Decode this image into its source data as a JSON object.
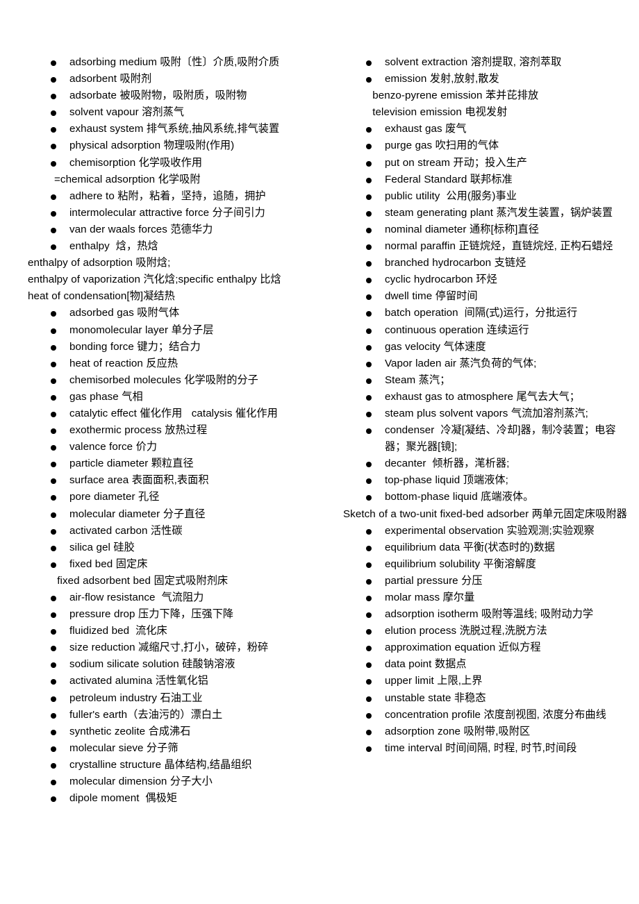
{
  "document": {
    "type": "bilingual-glossary",
    "subject": "Adsorption engineering English-Chinese vocabulary",
    "background_color": "#ffffff",
    "text_color": "#000000"
  },
  "left_column": [
    {
      "style": "bulleted",
      "text": "adsorbing medium 吸附〔性〕介质,吸附介质"
    },
    {
      "style": "bulleted",
      "text": "adsorbent 吸附剂"
    },
    {
      "style": "bulleted",
      "text": "adsorbate 被吸附物，吸附质，吸附物"
    },
    {
      "style": "bulleted",
      "text": "solvent vapour 溶剂蒸气"
    },
    {
      "style": "bulleted",
      "text": "exhaust system 排气系统,抽风系统,排气装置"
    },
    {
      "style": "bulleted",
      "text": "physical adsorption 物理吸附(作用)"
    },
    {
      "style": "bulleted",
      "text": "chemisorption 化学吸收作用"
    },
    {
      "style": "indented",
      "text": "=chemical adsorption 化学吸附"
    },
    {
      "style": "bulleted",
      "text": "adhere to 粘附，粘着，坚持，追随，拥护"
    },
    {
      "style": "bulleted",
      "text": "intermolecular attractive force 分子间引力"
    },
    {
      "style": "bulleted",
      "text": "van der waals forces 范德华力"
    },
    {
      "style": "bulleted",
      "text": "enthalpy  焓，热焓"
    },
    {
      "style": "flush",
      "text": "enthalpy of adsorption 吸附焓;"
    },
    {
      "style": "flush",
      "text": "enthalpy of vaporization 汽化焓;specific enthalpy 比焓"
    },
    {
      "style": "flush",
      "text": "heat of condensation[物]凝结热"
    },
    {
      "style": "bulleted",
      "text": "adsorbed gas 吸附气体"
    },
    {
      "style": "bulleted",
      "text": "monomolecular layer 单分子层"
    },
    {
      "style": "bulleted",
      "text": "bonding force 键力；结合力"
    },
    {
      "style": "bulleted",
      "text": "heat of reaction 反应热"
    },
    {
      "style": "bulleted",
      "text": "chemisorbed molecules 化学吸附的分子"
    },
    {
      "style": "bulleted",
      "text": "gas phase 气相"
    },
    {
      "style": "bulleted",
      "text": "catalytic effect 催化作用   catalysis 催化作用"
    },
    {
      "style": "bulleted",
      "text": "exothermic process 放热过程"
    },
    {
      "style": "bulleted",
      "text": "valence force 价力"
    },
    {
      "style": "bulleted",
      "text": "particle diameter 颗粒直径"
    },
    {
      "style": "bulleted",
      "text": "surface area 表面面积,表面积"
    },
    {
      "style": "bulleted",
      "text": "pore diameter 孔径"
    },
    {
      "style": "bulleted",
      "text": "molecular diameter 分子直径"
    },
    {
      "style": "bulleted",
      "text": "activated carbon 活性碳"
    },
    {
      "style": "bulleted",
      "text": "silica gel 硅胶"
    },
    {
      "style": "bulleted",
      "text": "fixed bed 固定床"
    },
    {
      "style": "indented",
      "text": " fixed adsorbent bed 固定式吸附剂床"
    },
    {
      "style": "bulleted",
      "text": "air-flow resistance  气流阻力"
    },
    {
      "style": "bulleted",
      "text": "pressure drop 压力下降，压强下降"
    },
    {
      "style": "bulleted",
      "text": "fluidized bed  流化床"
    },
    {
      "style": "bulleted",
      "text": "size reduction 减缩尺寸,打小，破碎，粉碎"
    },
    {
      "style": "bulleted",
      "text": "sodium silicate solution 硅酸钠溶液"
    },
    {
      "style": "bulleted",
      "text": "activated alumina 活性氧化铝"
    },
    {
      "style": "bulleted",
      "text": "petroleum industry 石油工业"
    },
    {
      "style": "bulleted",
      "text": "fuller's earth（去油污的）漂白土"
    },
    {
      "style": "bulleted",
      "text": "synthetic zeolite 合成沸石"
    },
    {
      "style": "bulleted",
      "text": "molecular sieve 分子筛"
    },
    {
      "style": "bulleted",
      "text": "crystalline structure 晶体结构,结晶组织"
    },
    {
      "style": "bulleted",
      "text": "molecular dimension 分子大小"
    },
    {
      "style": "bulleted",
      "text": "dipole moment  偶极矩"
    }
  ],
  "right_column": [
    {
      "style": "bulleted",
      "text": "solvent extraction 溶剂提取, 溶剂萃取"
    },
    {
      "style": "bulleted",
      "text": "emission 发射,放射,散发"
    },
    {
      "style": "indented",
      "text": " benzo-pyrene emission 苯并芘排放"
    },
    {
      "style": "indented",
      "text": " television emission 电视发射"
    },
    {
      "style": "bulleted",
      "text": "exhaust gas 废气"
    },
    {
      "style": "bulleted",
      "text": "purge gas 吹扫用的气体"
    },
    {
      "style": "bulleted",
      "text": "put on stream 开动；投入生产"
    },
    {
      "style": "bulleted",
      "text": "Federal Standard 联邦标准"
    },
    {
      "style": "bulleted",
      "text": "public utility  公用(服务)事业"
    },
    {
      "style": "bulleted",
      "text": "steam generating plant 蒸汽发生装置，锅炉装置"
    },
    {
      "style": "bulleted",
      "text": "nominal diameter 通称[标称]直径"
    },
    {
      "style": "bulleted",
      "text": "normal paraffin 正链烷烃，直链烷烃, 正构石蜡烃"
    },
    {
      "style": "bulleted",
      "text": "branched hydrocarbon 支链烃"
    },
    {
      "style": "bulleted",
      "text": "cyclic hydrocarbon 环烃"
    },
    {
      "style": "bulleted",
      "text": "dwell time 停留时间"
    },
    {
      "style": "bulleted",
      "text": "batch operation  间隔(式)运行，分批运行"
    },
    {
      "style": "bulleted",
      "text": "continuous operation 连续运行"
    },
    {
      "style": "bulleted",
      "text": "gas velocity 气体速度"
    },
    {
      "style": "bulleted",
      "text": "Vapor laden air 蒸汽负荷的气体;"
    },
    {
      "style": "bulleted",
      "text": "Steam 蒸汽；"
    },
    {
      "style": "bulleted",
      "text": "exhaust gas to atmosphere 尾气去大气；"
    },
    {
      "style": "bulleted",
      "text": "steam plus solvent vapors 气流加溶剂蒸汽;"
    },
    {
      "style": "bulleted",
      "text": "condenser  冷凝[凝结、冷却]器，制冷装置；电容器；聚光器[镜];"
    },
    {
      "style": "bulleted",
      "text": "decanter  倾析器，滗析器;"
    },
    {
      "style": "bulleted",
      "text": "top-phase liquid 顶端液体;"
    },
    {
      "style": "bulleted",
      "text": "bottom-phase liquid 底端液体。"
    },
    {
      "style": "flush",
      "text": "Sketch of a two-unit fixed-bed adsorber 两单元固定床吸附器"
    },
    {
      "style": "bulleted",
      "text": "experimental observation 实验观测;实验观察"
    },
    {
      "style": "bulleted",
      "text": "equilibrium data 平衡(状态时的)数据"
    },
    {
      "style": "bulleted",
      "text": "equilibrium solubility 平衡溶解度"
    },
    {
      "style": "bulleted",
      "text": "partial pressure 分压"
    },
    {
      "style": "bulleted",
      "text": "molar mass 摩尔量"
    },
    {
      "style": "bulleted",
      "text": "adsorption isotherm 吸附等温线; 吸附动力学"
    },
    {
      "style": "bulleted",
      "text": "elution process 洗脱过程,洗脱方法"
    },
    {
      "style": "bulleted",
      "text": "approximation equation 近似方程"
    },
    {
      "style": "bulleted",
      "text": "data point 数据点"
    },
    {
      "style": "bulleted",
      "text": "upper limit 上限,上界"
    },
    {
      "style": "bulleted",
      "text": "unstable state 非稳态"
    },
    {
      "style": "bulleted",
      "text": "concentration profile 浓度剖视图, 浓度分布曲线"
    },
    {
      "style": "bulleted",
      "text": "adsorption zone 吸附带,吸附区"
    },
    {
      "style": "bulleted",
      "text": "time interval 时间间隔, 时程, 时节,时间段"
    }
  ]
}
